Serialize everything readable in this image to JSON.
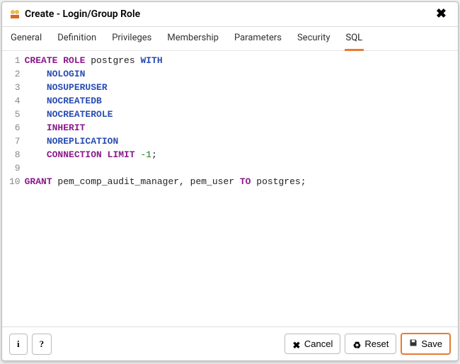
{
  "header": {
    "title": "Create - Login/Group Role"
  },
  "tabs": [
    {
      "label": "General",
      "active": false
    },
    {
      "label": "Definition",
      "active": false
    },
    {
      "label": "Privileges",
      "active": false
    },
    {
      "label": "Membership",
      "active": false
    },
    {
      "label": "Parameters",
      "active": false
    },
    {
      "label": "Security",
      "active": false
    },
    {
      "label": "SQL",
      "active": true
    }
  ],
  "sql": {
    "lines": [
      [
        {
          "t": "kw",
          "v": "CREATE ROLE"
        },
        {
          "t": "txt",
          "v": " postgres "
        },
        {
          "t": "kw2",
          "v": "WITH"
        }
      ],
      [
        {
          "t": "txt",
          "v": "    "
        },
        {
          "t": "kw2",
          "v": "NOLOGIN"
        }
      ],
      [
        {
          "t": "txt",
          "v": "    "
        },
        {
          "t": "kw2",
          "v": "NOSUPERUSER"
        }
      ],
      [
        {
          "t": "txt",
          "v": "    "
        },
        {
          "t": "kw2",
          "v": "NOCREATEDB"
        }
      ],
      [
        {
          "t": "txt",
          "v": "    "
        },
        {
          "t": "kw2",
          "v": "NOCREATEROLE"
        }
      ],
      [
        {
          "t": "txt",
          "v": "    "
        },
        {
          "t": "kw",
          "v": "INHERIT"
        }
      ],
      [
        {
          "t": "txt",
          "v": "    "
        },
        {
          "t": "kw2",
          "v": "NOREPLICATION"
        }
      ],
      [
        {
          "t": "txt",
          "v": "    "
        },
        {
          "t": "kw",
          "v": "CONNECTION LIMIT"
        },
        {
          "t": "txt",
          "v": " "
        },
        {
          "t": "num",
          "v": "-1"
        },
        {
          "t": "txt",
          "v": ";"
        }
      ],
      [],
      [
        {
          "t": "kw",
          "v": "GRANT"
        },
        {
          "t": "txt",
          "v": " pem_comp_audit_manager, pem_user "
        },
        {
          "t": "kw",
          "v": "TO"
        },
        {
          "t": "txt",
          "v": " postgres;"
        }
      ]
    ]
  },
  "footer": {
    "info_glyph": "i",
    "help_glyph": "?",
    "cancel_label": "Cancel",
    "reset_label": "Reset",
    "save_label": "Save"
  }
}
